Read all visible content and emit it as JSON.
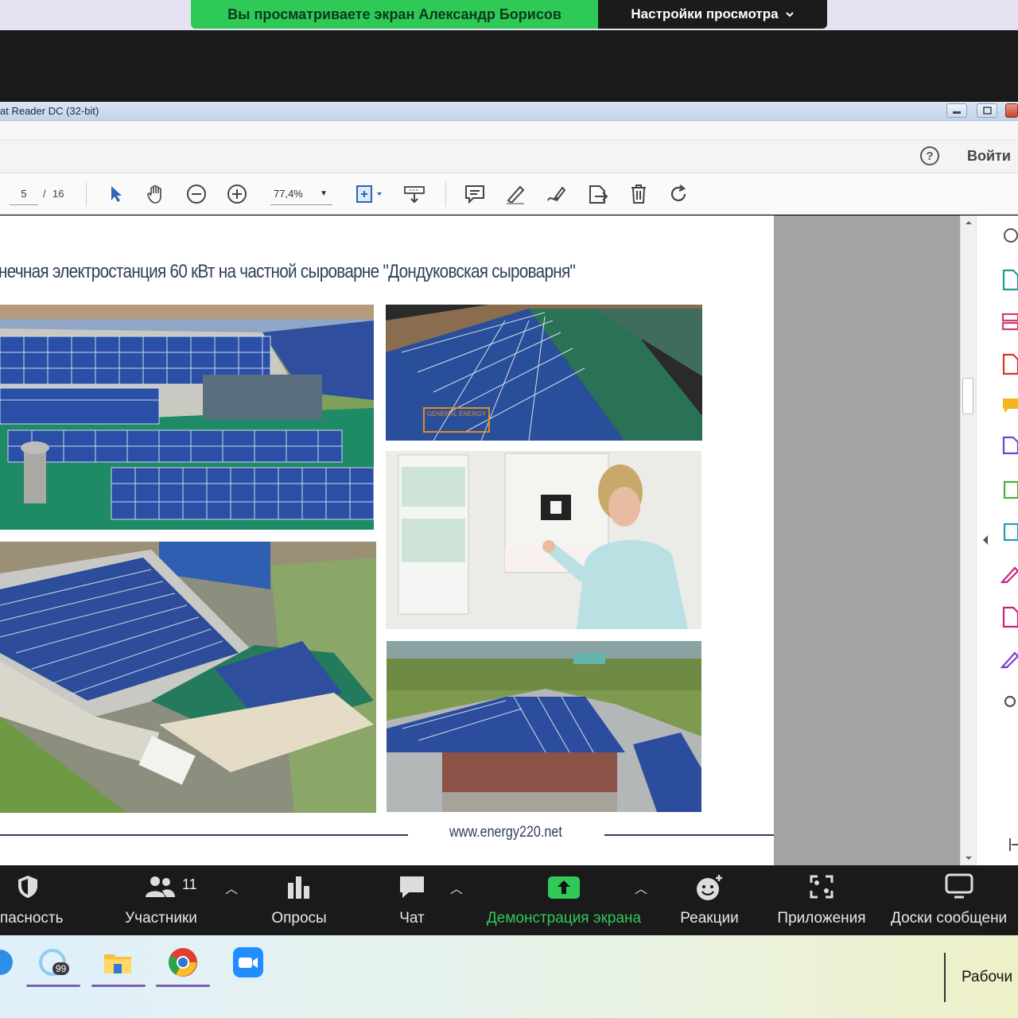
{
  "zoom": {
    "share_banner": "Вы просматриваете экран Александр Борисов",
    "view_settings": "Настройки просмотра",
    "toolbar": {
      "security": "пасность",
      "participants": "Участники",
      "participants_count": "11",
      "polls": "Опросы",
      "chat": "Чат",
      "share_screen": "Демонстрация экрана",
      "reactions": "Реакции",
      "apps": "Приложения",
      "whiteboards": "Доски сообщени"
    }
  },
  "acrobat": {
    "title": "at Reader DC (32-bit)",
    "login": "Войти",
    "help": "?",
    "page_current": "5",
    "page_sep": "/",
    "page_total": "16",
    "zoom": "77,4%"
  },
  "document": {
    "title": "нечная электростанция 60 кВт на частной сыроварне \"Дондуковская сыроварня\"",
    "url": "www.energy220.net",
    "stamp_text": "GENERAL ENERGY"
  },
  "taskbar": {
    "badge": "99",
    "desktop_label": "Рабочи"
  },
  "colors": {
    "zoom_green": "#2fc958",
    "zoom_bar": "#1a1a1a",
    "doc_title": "#2e3f5a",
    "acrobat_icon_magenta": "#c8237d"
  }
}
